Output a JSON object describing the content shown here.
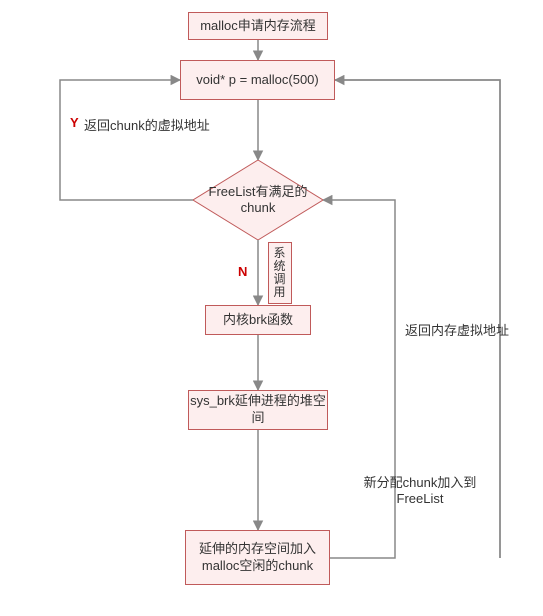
{
  "nodes": {
    "title": "malloc申请内存流程",
    "call": "void* p = malloc(500)",
    "decision": "FreeList有满足的chunk",
    "syscall_box": "系统调用",
    "brk": "内核brk函数",
    "sysbrk": "sys_brk延伸进程的堆空间",
    "extend": "延伸的内存空间加入malloc空闲的chunk"
  },
  "edges": {
    "yes": "Y",
    "no": "N",
    "return_chunk": "返回chunk的虚拟地址",
    "return_mem": "返回内存虚拟地址",
    "new_chunk": "新分配chunk加入到 FreeList"
  },
  "colors": {
    "node_fill": "#fdeeee",
    "node_border": "#c05a5a",
    "arrow": "#888888",
    "yn": "#cc0000"
  }
}
